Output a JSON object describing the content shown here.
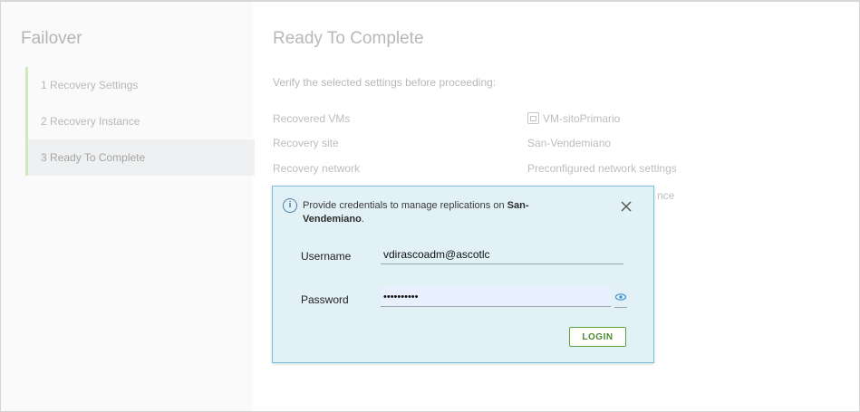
{
  "wizard": {
    "title": "Failover",
    "steps": [
      {
        "label": "1 Recovery Settings"
      },
      {
        "label": "2 Recovery Instance"
      },
      {
        "label": "3 Ready To Complete"
      }
    ],
    "active_step": 3
  },
  "content": {
    "title": "Ready To Complete",
    "subtitle": "Verify the selected settings before proceeding:",
    "rows": [
      {
        "label": "Recovered VMs",
        "value": "VM-sitoPrimario",
        "icon": "vm-icon"
      },
      {
        "label": "Recovery site",
        "value": "San-Vendemiano"
      },
      {
        "label": "Recovery network",
        "value": "Preconfigured network settings"
      }
    ],
    "partial_text": "nce"
  },
  "credentials": {
    "message_prefix": "Provide credentials to manage replications on ",
    "site_name": "San-Vendemiano",
    "message_suffix": ".",
    "username_label": "Username",
    "username_value": "vdirascoadm@ascotlc",
    "password_label": "Password",
    "password_value": "••••••••••",
    "login_label": "LOGIN",
    "icons": {
      "info": "info-icon",
      "close": "close-icon",
      "reveal": "eye-icon"
    },
    "colors": {
      "popover_bg": "#e1f1f6",
      "popover_border": "#7cc3dd",
      "login": "#58a33a"
    }
  }
}
